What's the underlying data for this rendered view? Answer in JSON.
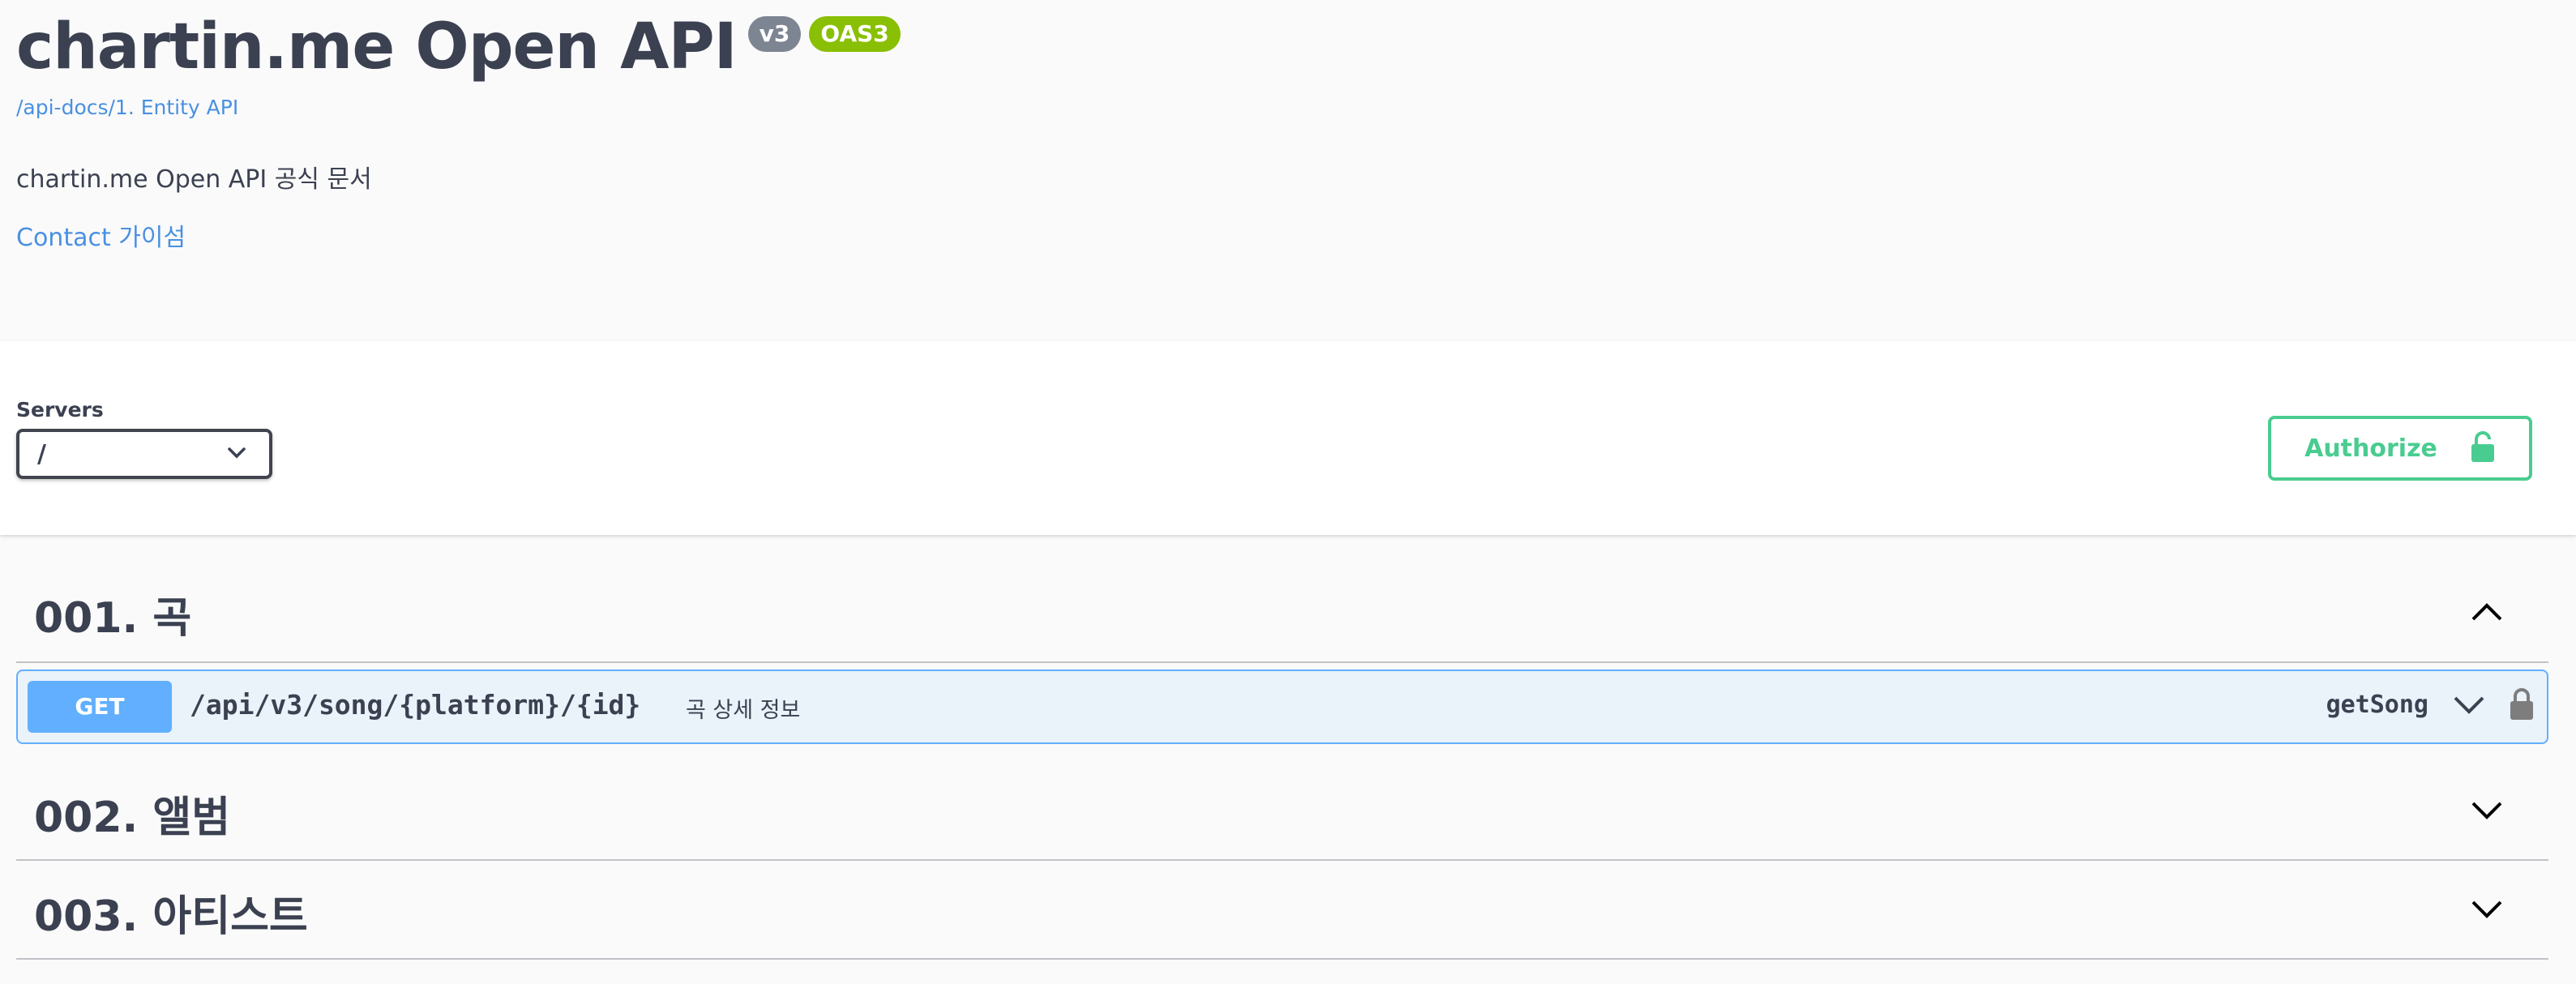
{
  "info": {
    "title": "chartin.me Open API",
    "version_badge": "v3",
    "spec_badge": "OAS3",
    "spec_url": "/api-docs/1. Entity API",
    "description": "chartin.me Open API 공식 문서",
    "contact_label": "Contact 가이섬"
  },
  "servers": {
    "label": "Servers",
    "selected": "/"
  },
  "authorize": {
    "label": "Authorize"
  },
  "tags": [
    {
      "title": "001. 곡",
      "expanded": true
    },
    {
      "title": "002. 앨범",
      "expanded": false
    },
    {
      "title": "003. 아티스트",
      "expanded": false
    }
  ],
  "operation": {
    "method": "GET",
    "path": "/api/v3/song/{platform}/{id}",
    "summary": "곡 상세 정보",
    "operation_id": "getSong"
  },
  "colors": {
    "get": "#61affe",
    "authorize": "#49cc90",
    "oas_badge": "#89bf04",
    "version_badge": "#7d8492",
    "link": "#4990e2"
  }
}
